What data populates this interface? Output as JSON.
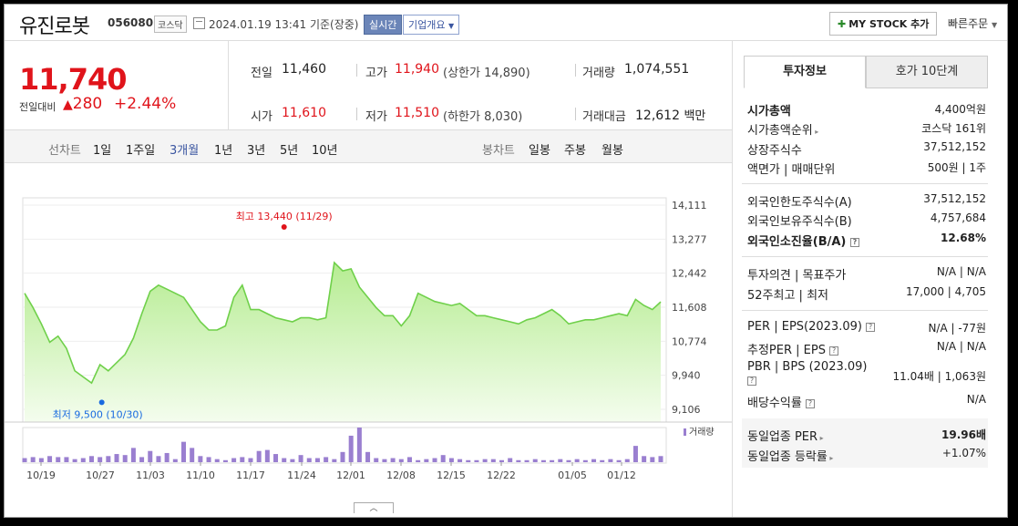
{
  "header": {
    "stock_name": "유진로봇",
    "stock_code": "056080",
    "market": "코스닥",
    "datetime": "2024.01.19 13:41",
    "basis": "기준(장중)",
    "realtime_label": "실시간",
    "corp_overview_label": "기업개요",
    "mystock_label": "MY STOCK 추가",
    "quick_order_label": "빠른주문"
  },
  "price": {
    "current": "11,740",
    "change_label": "전일대비",
    "change_value": "280",
    "change_pct": "+2.44%"
  },
  "info": {
    "prev_label": "전일",
    "prev_value": "11,460",
    "high_label": "고가",
    "high_value": "11,940",
    "upper_limit": "(상한가 14,890)",
    "volume_label": "거래량",
    "volume_value": "1,074,551",
    "open_label": "시가",
    "open_value": "11,610",
    "low_label": "저가",
    "low_value": "11,510",
    "lower_limit": "(하한가 8,030)",
    "amount_label": "거래대금",
    "amount_value": "12,612",
    "amount_unit": "백만"
  },
  "line_tabs": {
    "label": "선차트",
    "items": [
      "1일",
      "1주일",
      "3개월",
      "1년",
      "3년",
      "5년",
      "10년"
    ],
    "selected": "3개월"
  },
  "candle_tabs": {
    "label": "봉차트",
    "items": [
      "일봉",
      "주봉",
      "월봉"
    ]
  },
  "right_tabs": [
    "투자정보",
    "호가 10단계"
  ],
  "invest": {
    "market_cap_label": "시가총액",
    "market_cap": "4,400억원",
    "rank_label": "시가총액순위",
    "rank": "코스닥 161위",
    "shares_label": "상장주식수",
    "shares": "37,512,152",
    "par_label": "액면가 | 매매단위",
    "par": "500원 | 1주",
    "foreign_limit_label": "외국인한도주식수(A)",
    "foreign_limit": "37,512,152",
    "foreign_hold_label": "외국인보유주식수(B)",
    "foreign_hold": "4,757,684",
    "foreign_ratio_label": "외국인소진율(B/A)",
    "foreign_ratio": "12.68%",
    "opinion_label": "투자의견 | 목표주가",
    "opinion": "N/A | N/A",
    "w52_label": "52주최고 | 최저",
    "w52": "17,000 | 4,705",
    "per_label": "PER | EPS(2023.09)",
    "per": "N/A | -77원",
    "est_per_label": "추정PER | EPS",
    "est_per": "N/A | N/A",
    "pbr_label": "PBR | BPS (2023.09)",
    "pbr": "11.04배 | 1,063원",
    "div_label": "배당수익률",
    "div": "N/A",
    "ind_per_label": "동일업종 PER",
    "ind_per": "19.96배",
    "ind_chg_label": "동일업종 등락률",
    "ind_chg": "+1.07%"
  },
  "chart_data": {
    "type": "area",
    "y_ticks": [
      "14,111",
      "13,277",
      "12,442",
      "11,608",
      "10,774",
      "9,940",
      "9,106"
    ],
    "ylim": [
      9106,
      14111
    ],
    "x_ticks": [
      "10/19",
      "10/27",
      "11/03",
      "11/10",
      "11/17",
      "11/24",
      "12/01",
      "12/08",
      "12/15",
      "12/22",
      "01/05",
      "01/12"
    ],
    "high_label": "최고 13,440 (11/29)",
    "low_label": "최저 9,500 (10/30)",
    "high_value": 13440,
    "low_value": 9500,
    "high_index": 31,
    "low_index": 9,
    "volume_legend": "거래량",
    "prices": [
      11950,
      11600,
      11200,
      10750,
      10900,
      10600,
      10050,
      9900,
      9750,
      10200,
      10050,
      10250,
      10450,
      10850,
      11450,
      12000,
      12150,
      12050,
      11950,
      11850,
      11550,
      11250,
      11050,
      11050,
      11150,
      11850,
      12150,
      11550,
      11550,
      11450,
      11350,
      11300,
      11250,
      11350,
      11350,
      11300,
      11350,
      12700,
      12500,
      12550,
      12100,
      11850,
      11600,
      11400,
      11400,
      11150,
      11400,
      11950,
      11850,
      11750,
      11700,
      11650,
      11700,
      11550,
      11400,
      11400,
      11350,
      11300,
      11250,
      11200,
      11300,
      11350,
      11450,
      11550,
      11400,
      11200,
      11250,
      11300,
      11300,
      11350,
      11400,
      11450,
      11400,
      11800,
      11650,
      11550,
      11740
    ],
    "volumes": [
      0.2,
      0.25,
      0.2,
      0.3,
      0.25,
      0.25,
      0.15,
      0.2,
      0.3,
      0.25,
      0.3,
      0.4,
      0.35,
      0.7,
      0.25,
      0.55,
      0.3,
      0.45,
      0.15,
      1.0,
      0.7,
      0.3,
      0.25,
      0.15,
      0.1,
      0.2,
      0.25,
      0.2,
      0.55,
      0.6,
      0.4,
      0.2,
      0.15,
      0.35,
      0.2,
      0.2,
      0.25,
      0.15,
      0.5,
      1.3,
      1.7,
      0.5,
      0.2,
      0.15,
      0.2,
      0.15,
      0.25,
      0.1,
      0.15,
      0.2,
      0.35,
      0.2,
      0.15,
      0.1,
      0.1,
      0.15,
      0.15,
      0.1,
      0.2,
      0.1,
      0.1,
      0.15,
      0.1,
      0.1,
      0.15,
      0.1,
      0.15,
      0.1,
      0.15,
      0.1,
      0.15,
      0.1,
      0.15,
      0.8,
      0.3,
      0.25,
      0.3
    ]
  },
  "expander_icon": "chevron-up-icon"
}
